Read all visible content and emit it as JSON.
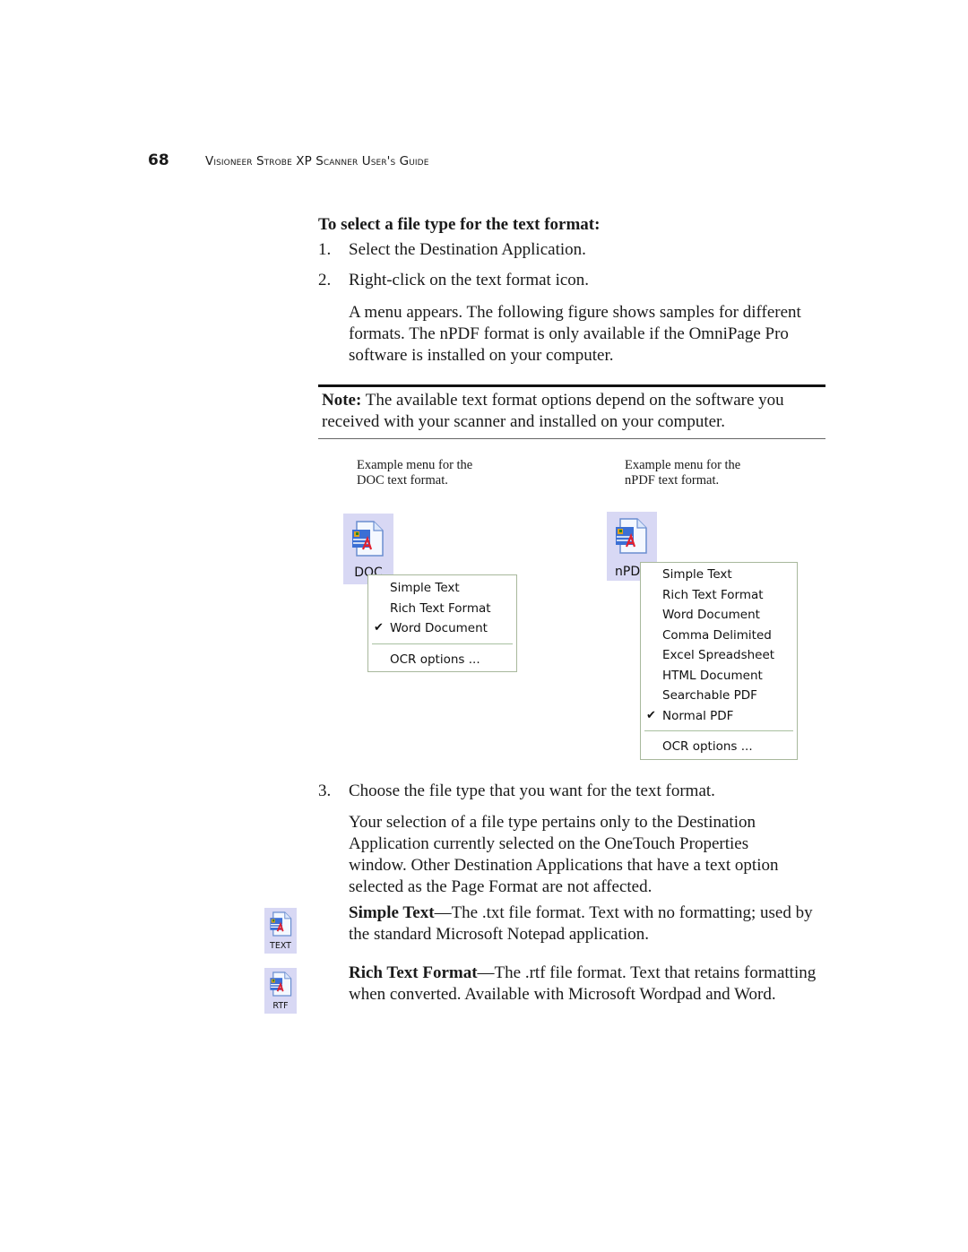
{
  "header": {
    "page_number": "68",
    "running_title": "Visioneer Strobe XP Scanner User's Guide"
  },
  "procedure": {
    "title": "To select a file type for the text format:",
    "steps": [
      {
        "num": "1.",
        "text": "Select the Destination Application."
      },
      {
        "num": "2.",
        "text": "Right-click on the text format icon."
      },
      {
        "num": "3.",
        "text": "Choose the file type that you want for the text format."
      }
    ],
    "step2_detail": "A menu appears. The following figure shows samples for different formats. The nPDF format is only available if the OmniPage Pro software is installed on your computer.",
    "step3_detail": "Your selection of a file type pertains only to the Destination Application currently selected on the OneTouch Properties window. Other Destination Applications that have a text option selected as the Page Format are not affected."
  },
  "note": {
    "label": "Note:",
    "text": " The available text format options depend on the software you received with your scanner and installed on your computer."
  },
  "figures": {
    "doc": {
      "caption_line1": "Example menu for the",
      "caption_line2": "DOC text format.",
      "icon_label": "DOC",
      "menu": {
        "items": [
          {
            "label": "Simple Text",
            "checked": false
          },
          {
            "label": "Rich Text Format",
            "checked": false
          },
          {
            "label": "Word Document",
            "checked": true
          }
        ],
        "footer_item": "OCR options ..."
      }
    },
    "npdf": {
      "caption_line1": "Example menu for the",
      "caption_line2": "nPDF text format.",
      "icon_label": "nPDF",
      "menu": {
        "items": [
          {
            "label": "Simple Text",
            "checked": false
          },
          {
            "label": "Rich Text Format",
            "checked": false
          },
          {
            "label": "Word Document",
            "checked": false
          },
          {
            "label": "Comma Delimited",
            "checked": false
          },
          {
            "label": "Excel Spreadsheet",
            "checked": false
          },
          {
            "label": "HTML Document",
            "checked": false
          },
          {
            "label": "Searchable PDF",
            "checked": false
          },
          {
            "label": "Normal PDF",
            "checked": true
          }
        ],
        "footer_item": "OCR options ..."
      }
    },
    "check_glyph": "✔"
  },
  "formats": [
    {
      "icon_label": "TEXT",
      "term": "Simple Text",
      "desc": "—The .txt file format. Text with no formatting; used by the standard Microsoft Notepad application."
    },
    {
      "icon_label": "RTF",
      "term": "Rich Text Format",
      "desc": "—The .rtf file format. Text that retains formatting when converted. Available with Microsoft Wordpad and Word."
    }
  ]
}
